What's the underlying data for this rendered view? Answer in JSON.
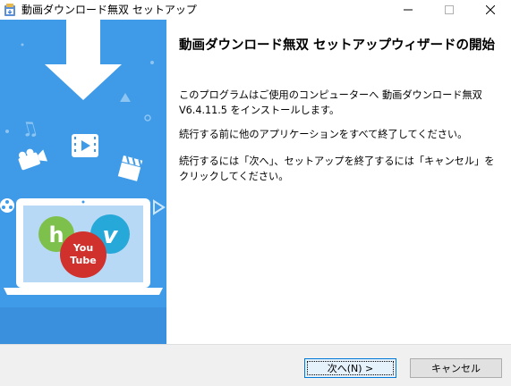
{
  "window": {
    "title": "動画ダウンロード無双 セットアップ"
  },
  "content": {
    "heading": "動画ダウンロード無双 セットアップウィザードの開始",
    "paragraph1": "このプログラムはご使用のコンピューターへ 動画ダウンロード無双 V6.4.11.5 をインストールします。",
    "paragraph2": "続行する前に他のアプリケーションをすべて終了してください。",
    "paragraph3": "続行するには「次へ」、セットアップを終了するには「キャンセル」をクリックしてください。"
  },
  "banner": {
    "logos": {
      "hulu_letter": "h",
      "vimeo_letter": "v",
      "youtube_line1": "You",
      "youtube_line2": "Tube"
    }
  },
  "buttons": {
    "next_label": "次へ(N) >",
    "cancel_label": "キャンセル"
  },
  "colors": {
    "banner_bg": "#3f9be7",
    "hulu": "#7dc04b",
    "vimeo": "#26a8d9",
    "youtube": "#d0312d"
  }
}
